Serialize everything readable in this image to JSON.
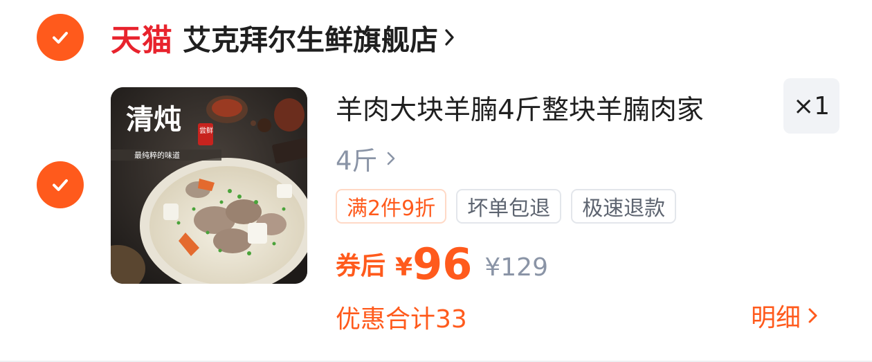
{
  "shop": {
    "platform_logo": "天猫",
    "name": "艾克拜尔生鲜旗舰店",
    "selected": true
  },
  "item": {
    "selected": true,
    "image": {
      "overlay_title": "清炖",
      "overlay_stamp": "尝鲜",
      "overlay_subtitle": "最纯粹的味道"
    },
    "title": "羊肉大块羊腩4斤整块羊腩肉家",
    "quantity": "×1",
    "spec": "4斤",
    "tags": [
      "满2件9折",
      "坏单包退",
      "极速退款"
    ],
    "price_label": "券后",
    "currency": "¥",
    "price": "96",
    "original_price": "¥129",
    "discount_total": "优惠合计33",
    "detail_link": "明细"
  },
  "colors": {
    "accent": "#ff5a1c",
    "tmall_red": "#e8232d",
    "muted": "#8a94a6"
  }
}
